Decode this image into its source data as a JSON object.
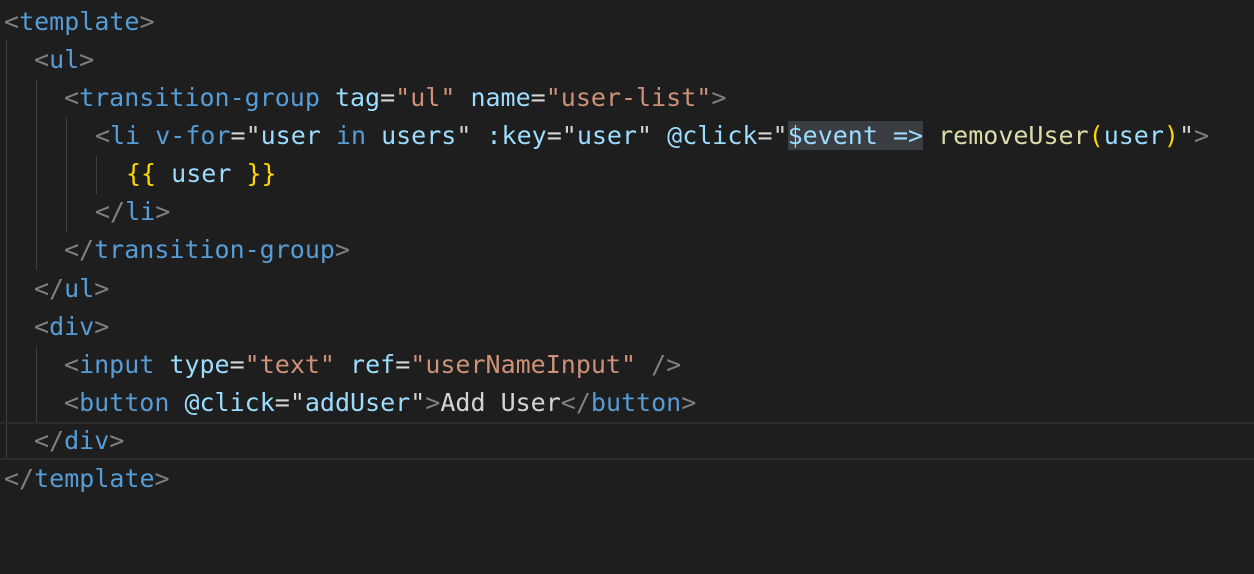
{
  "editor": {
    "colors": {
      "background": "#1e1e1e",
      "tag": "#569cd6",
      "attribute": "#9cdcfe",
      "string": "#ce9178",
      "punctuation": "#808080",
      "function": "#dcdcaa",
      "bracket": "#ffd700",
      "selection": "#3a3d41"
    },
    "lines": [
      [
        {
          "t": "<",
          "c": "punc"
        },
        {
          "t": "template",
          "c": "tag"
        },
        {
          "t": ">",
          "c": "punc"
        }
      ],
      [
        {
          "t": "<",
          "c": "punc"
        },
        {
          "t": "ul",
          "c": "tag"
        },
        {
          "t": ">",
          "c": "punc"
        }
      ],
      [
        {
          "t": "<",
          "c": "punc"
        },
        {
          "t": "transition-group",
          "c": "tag"
        },
        {
          "t": " ",
          "c": "text"
        },
        {
          "t": "tag",
          "c": "attr"
        },
        {
          "t": "=",
          "c": "eq"
        },
        {
          "t": "\"ul\"",
          "c": "str"
        },
        {
          "t": " ",
          "c": "text"
        },
        {
          "t": "name",
          "c": "attr"
        },
        {
          "t": "=",
          "c": "eq"
        },
        {
          "t": "\"user-list\"",
          "c": "str"
        },
        {
          "t": ">",
          "c": "punc"
        }
      ],
      [
        {
          "t": "<",
          "c": "punc"
        },
        {
          "t": "li",
          "c": "tag"
        },
        {
          "t": " ",
          "c": "text"
        },
        {
          "t": "v-for",
          "c": "tag"
        },
        {
          "t": "=",
          "c": "eq"
        },
        {
          "t": "\"",
          "c": "text"
        },
        {
          "t": "user",
          "c": "var"
        },
        {
          "t": " ",
          "c": "text"
        },
        {
          "t": "in",
          "c": "tag"
        },
        {
          "t": " ",
          "c": "text"
        },
        {
          "t": "users",
          "c": "var"
        },
        {
          "t": "\"",
          "c": "text"
        },
        {
          "t": " ",
          "c": "text"
        },
        {
          "t": ":key",
          "c": "attr"
        },
        {
          "t": "=",
          "c": "eq"
        },
        {
          "t": "\"",
          "c": "text"
        },
        {
          "t": "user",
          "c": "var"
        },
        {
          "t": "\"",
          "c": "text"
        },
        {
          "t": " ",
          "c": "text"
        },
        {
          "t": "@click",
          "c": "attr"
        },
        {
          "t": "=",
          "c": "eq"
        },
        {
          "t": "\"",
          "c": "text"
        },
        {
          "t": "$event =>",
          "c": "var",
          "sel": true
        },
        {
          "t": " ",
          "c": "text"
        },
        {
          "t": "removeUser",
          "c": "fn"
        },
        {
          "t": "(",
          "c": "paren"
        },
        {
          "t": "user",
          "c": "var"
        },
        {
          "t": ")",
          "c": "paren"
        },
        {
          "t": "\"",
          "c": "text"
        },
        {
          "t": ">",
          "c": "punc"
        }
      ],
      [
        {
          "t": "{{",
          "c": "mus"
        },
        {
          "t": " ",
          "c": "text"
        },
        {
          "t": "user",
          "c": "var"
        },
        {
          "t": " ",
          "c": "text"
        },
        {
          "t": "}}",
          "c": "mus"
        }
      ],
      [
        {
          "t": "</",
          "c": "punc"
        },
        {
          "t": "li",
          "c": "tag"
        },
        {
          "t": ">",
          "c": "punc"
        }
      ],
      [
        {
          "t": "</",
          "c": "punc"
        },
        {
          "t": "transition-group",
          "c": "tag"
        },
        {
          "t": ">",
          "c": "punc"
        }
      ],
      [
        {
          "t": "</",
          "c": "punc"
        },
        {
          "t": "ul",
          "c": "tag"
        },
        {
          "t": ">",
          "c": "punc"
        }
      ],
      [
        {
          "t": "<",
          "c": "punc"
        },
        {
          "t": "div",
          "c": "tag"
        },
        {
          "t": ">",
          "c": "punc"
        }
      ],
      [
        {
          "t": "<",
          "c": "punc"
        },
        {
          "t": "input",
          "c": "tag"
        },
        {
          "t": " ",
          "c": "text"
        },
        {
          "t": "type",
          "c": "attr"
        },
        {
          "t": "=",
          "c": "eq"
        },
        {
          "t": "\"text\"",
          "c": "str"
        },
        {
          "t": " ",
          "c": "text"
        },
        {
          "t": "ref",
          "c": "attr"
        },
        {
          "t": "=",
          "c": "eq"
        },
        {
          "t": "\"userNameInput\"",
          "c": "str"
        },
        {
          "t": " ",
          "c": "text"
        },
        {
          "t": "/>",
          "c": "punc"
        }
      ],
      [
        {
          "t": "<",
          "c": "punc"
        },
        {
          "t": "button",
          "c": "tag"
        },
        {
          "t": " ",
          "c": "text"
        },
        {
          "t": "@click",
          "c": "attr"
        },
        {
          "t": "=",
          "c": "eq"
        },
        {
          "t": "\"",
          "c": "text"
        },
        {
          "t": "addUser",
          "c": "var"
        },
        {
          "t": "\"",
          "c": "text"
        },
        {
          "t": ">",
          "c": "punc"
        },
        {
          "t": "Add User",
          "c": "text"
        },
        {
          "t": "</",
          "c": "punc"
        },
        {
          "t": "button",
          "c": "tag"
        },
        {
          "t": ">",
          "c": "punc"
        }
      ],
      [
        {
          "t": "</",
          "c": "punc"
        },
        {
          "t": "div",
          "c": "tag"
        },
        {
          "t": ">",
          "c": "punc"
        }
      ],
      [
        {
          "t": "</",
          "c": "punc"
        },
        {
          "t": "template",
          "c": "tag"
        },
        {
          "t": ">",
          "c": "punc"
        }
      ]
    ]
  }
}
